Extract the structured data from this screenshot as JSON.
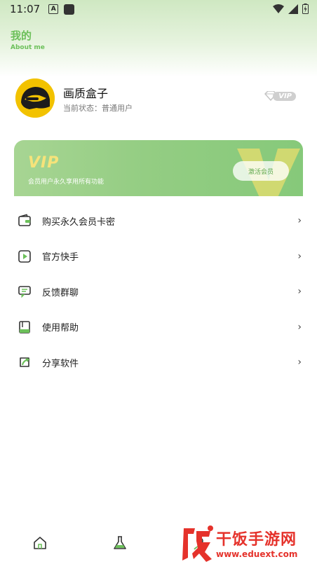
{
  "status_bar": {
    "time": "11:07",
    "notif_a": "A"
  },
  "header": {
    "title": "我的",
    "subtitle": "About me"
  },
  "profile": {
    "name": "画质盒子",
    "status": "当前状态：普通用户",
    "badge": "VIP"
  },
  "vip_card": {
    "title": "VIP",
    "description": "会员用户永久享用所有功能",
    "button": "激活会员",
    "accent": "#8ccb7c"
  },
  "menu": [
    {
      "label": "购买永久会员卡密",
      "icon": "wallet-icon"
    },
    {
      "label": "官方快手",
      "icon": "play-square-icon"
    },
    {
      "label": "反馈群聊",
      "icon": "chat-icon"
    },
    {
      "label": "使用帮助",
      "icon": "book-icon"
    },
    {
      "label": "分享软件",
      "icon": "share-icon"
    }
  ],
  "bottom_nav": [
    {
      "name": "home",
      "icon": "home-icon"
    },
    {
      "name": "lab",
      "icon": "flask-icon"
    },
    {
      "name": "me",
      "icon": "person-icon"
    }
  ],
  "watermark": {
    "text": "干饭手游网",
    "url": "www.eduext.com"
  }
}
